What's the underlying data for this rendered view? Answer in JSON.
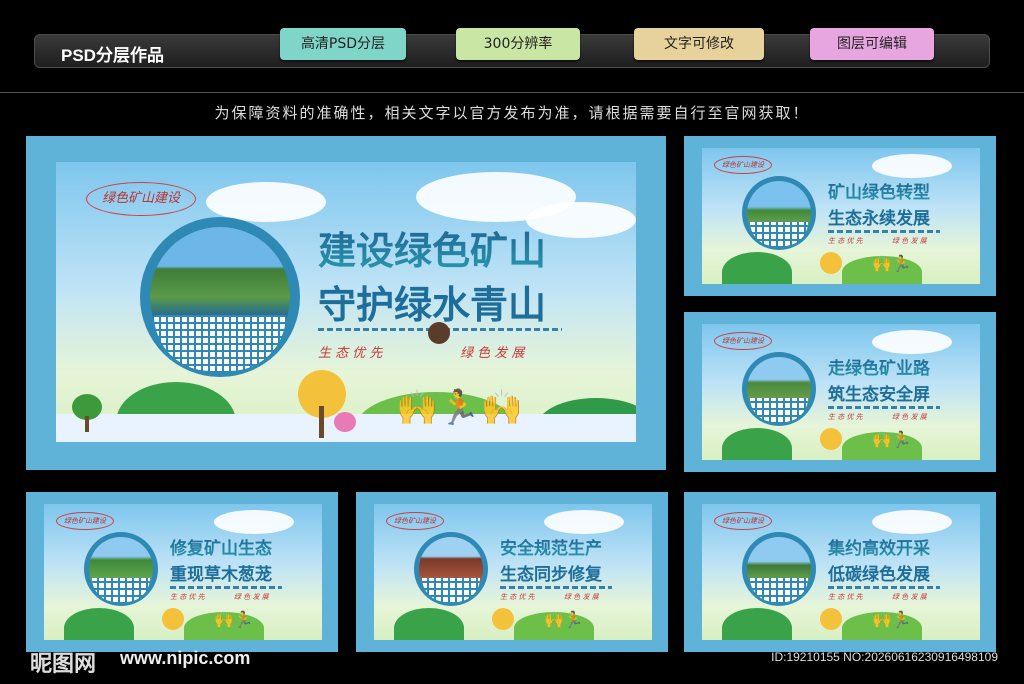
{
  "header": {
    "title": "PSD分层作品",
    "tags": [
      "高清PSD分层",
      "300分辨率",
      "文字可修改",
      "图层可编辑"
    ]
  },
  "notice": "为保障资料的准确性，相关文字以官方发布为准，请根据需要自行至官网获取！",
  "colors": {
    "tag1": "#7fd6c8",
    "tag2": "#c9e6a4",
    "tag3": "#e6d29a",
    "tag4": "#e8a6e0"
  },
  "boards": [
    {
      "seal": "绿色矿山建设",
      "line1": "建设绿色矿山",
      "line2": "守护绿水青山",
      "slogan_left": "生 态 优 先",
      "slogan_right": "绿 色 发 展"
    },
    {
      "seal": "绿色矿山建设",
      "line1": "矿山绿色转型",
      "line2": "生态永续发展",
      "slogan_left": "生 态 优 先",
      "slogan_right": "绿 色 发 展"
    },
    {
      "seal": "绿色矿山建设",
      "line1": "走绿色矿业路",
      "line2": "筑生态安全屏",
      "slogan_left": "生 态 优 先",
      "slogan_right": "绿 色 发 展"
    },
    {
      "seal": "绿色矿山建设",
      "line1": "修复矿山生态",
      "line2": "重现草木葱茏",
      "slogan_left": "生 态 优 先",
      "slogan_right": "绿 色 发 展"
    },
    {
      "seal": "绿色矿山建设",
      "line1": "安全规范生产",
      "line2": "生态同步修复",
      "slogan_left": "生 态 优 先",
      "slogan_right": "绿 色 发 展"
    },
    {
      "seal": "绿色矿山建设",
      "line1": "集约高效开采",
      "line2": "低碳绿色发展",
      "slogan_left": "生 态 优 先",
      "slogan_right": "绿 色 发 展"
    }
  ],
  "watermark": {
    "logo": "昵图网",
    "url": "www.nipic.com",
    "id": "ID:19210155 NO:20260616230916498109"
  }
}
